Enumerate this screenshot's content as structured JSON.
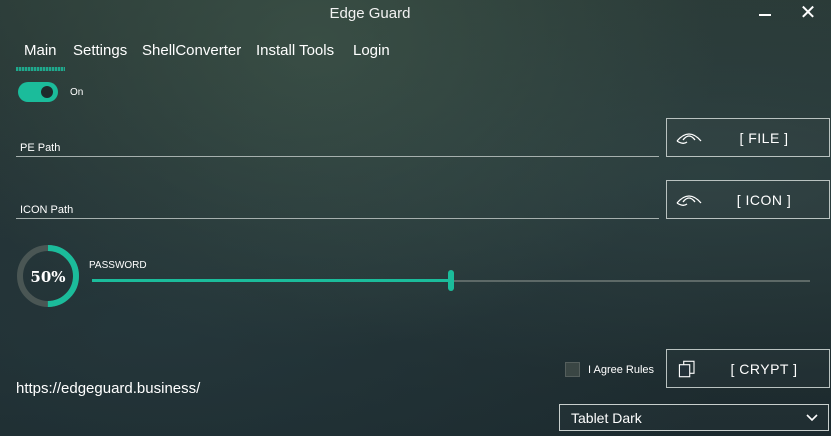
{
  "window": {
    "title": "Edge Guard",
    "minimize_icon": "minimize-icon",
    "close_icon": "close-icon",
    "close_glyph": "✕"
  },
  "tabs": [
    {
      "label": "Main",
      "active": true
    },
    {
      "label": "Settings"
    },
    {
      "label": "ShellConverter"
    },
    {
      "label": "Install Tools"
    },
    {
      "label": "Login"
    }
  ],
  "toggle": {
    "label": "On",
    "state": true
  },
  "pe_path": {
    "placeholder": "PE Path",
    "value": ""
  },
  "file_button": {
    "label": "[ FILE ]",
    "icon": "eye-icon"
  },
  "icon_path": {
    "placeholder": "ICON Path",
    "value": ""
  },
  "icon_button": {
    "label": "[ ICON ]",
    "icon": "eye-icon"
  },
  "progress": {
    "value": 0.5,
    "label": "50%"
  },
  "password": {
    "label": "PASSWORD",
    "slider_value": 0.5
  },
  "agree": {
    "label": "I Agree Rules",
    "checked": false
  },
  "crypt_button": {
    "label": "[ CRYPT ]",
    "icon": "copy-icon"
  },
  "url": "https://edgeguard.business/",
  "theme_select": {
    "selected": "Tablet Dark",
    "icon": "chevron-down-icon"
  },
  "colors": {
    "accent": "#1bbc9b",
    "ring_track": "#4a5654"
  }
}
